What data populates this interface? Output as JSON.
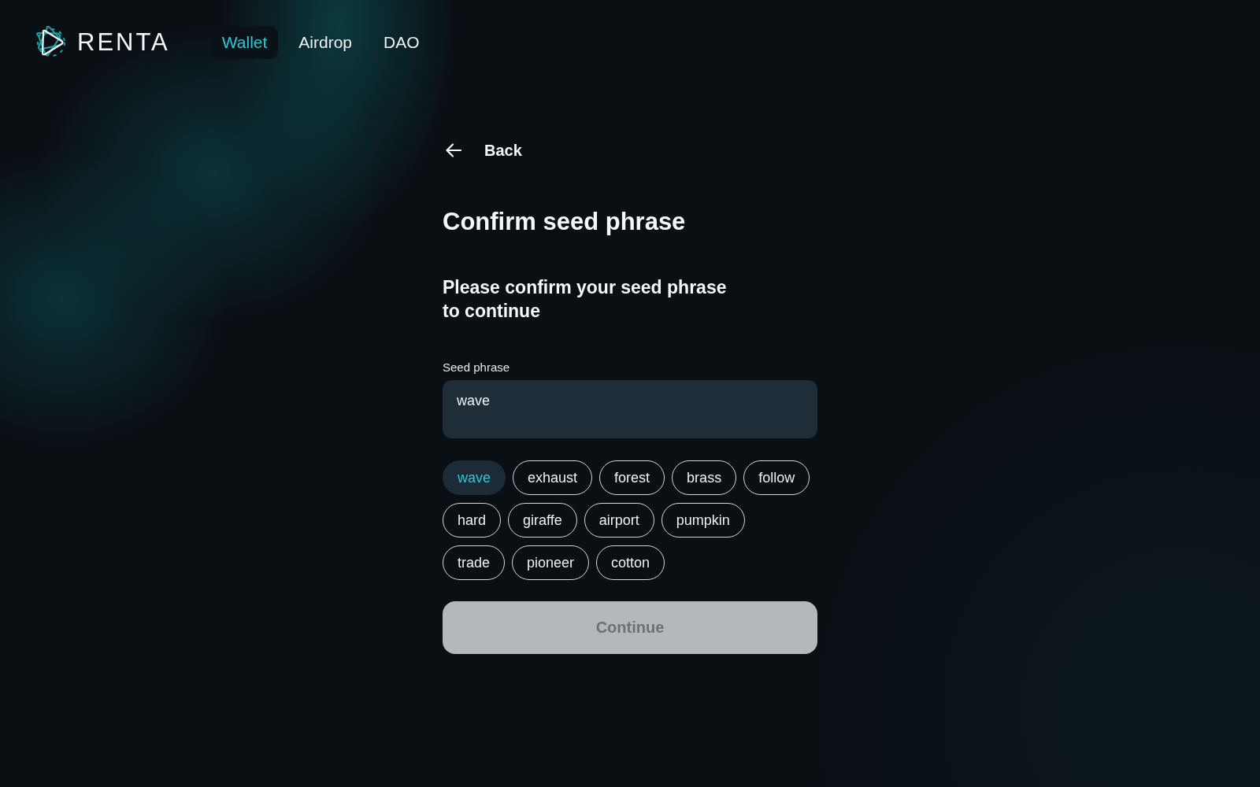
{
  "header": {
    "logo": {
      "text": "RENTA"
    },
    "nav": [
      {
        "label": "Wallet",
        "selected": true
      },
      {
        "label": "Airdrop",
        "selected": false
      },
      {
        "label": "DAO",
        "selected": false
      }
    ]
  },
  "back": {
    "label": "Back"
  },
  "title": "Confirm seed phrase",
  "subtitle": "Please confirm your seed phrase to continue",
  "field": {
    "label": "Seed phrase",
    "value": "wave"
  },
  "words": [
    {
      "label": "wave",
      "selected": true
    },
    {
      "label": "exhaust",
      "selected": false
    },
    {
      "label": "forest",
      "selected": false
    },
    {
      "label": "brass",
      "selected": false
    },
    {
      "label": "follow",
      "selected": false
    },
    {
      "label": "hard",
      "selected": false
    },
    {
      "label": "giraffe",
      "selected": false
    },
    {
      "label": "airport",
      "selected": false
    },
    {
      "label": "pumpkin",
      "selected": false
    },
    {
      "label": "trade",
      "selected": false
    },
    {
      "label": "pioneer",
      "selected": false
    },
    {
      "label": "cotton",
      "selected": false
    }
  ],
  "continue": {
    "label": "Continue",
    "disabled": true
  }
}
